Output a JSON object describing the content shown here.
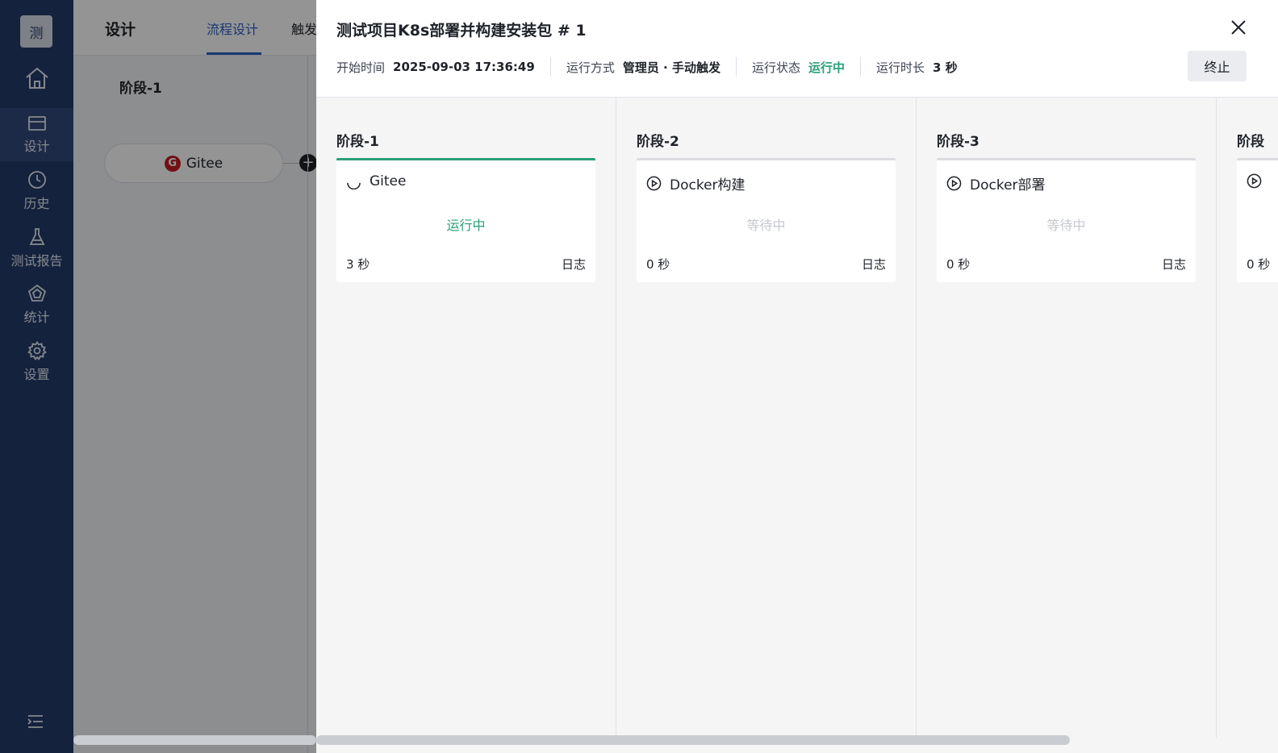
{
  "nav": {
    "logo": "测",
    "items": [
      {
        "label": "设计",
        "icon": "design-icon",
        "active": true
      },
      {
        "label": "历史",
        "icon": "clock-icon",
        "active": false
      },
      {
        "label": "测试报告",
        "icon": "flask-icon",
        "active": false
      },
      {
        "label": "统计",
        "icon": "chart-icon",
        "active": false
      },
      {
        "label": "设置",
        "icon": "gear-icon",
        "active": false
      }
    ]
  },
  "page": {
    "title": "设计",
    "tabs": [
      {
        "label": "流程设计",
        "active": true
      },
      {
        "label": "触发",
        "active": false
      }
    ],
    "stage_title": "阶段-1",
    "source_node": "Gitee"
  },
  "drawer": {
    "title": "测试项目K8s部署并构建安装包 # 1",
    "meta": {
      "start_label": "开始时间",
      "start_value": "2025-09-03 17:36:49",
      "mode_label": "运行方式",
      "mode_value": "管理员 · 手动触发",
      "status_label": "运行状态",
      "status_value": "运行中",
      "duration_label": "运行时长",
      "duration_value": "3 秒"
    },
    "stop_label": "终止",
    "stages": [
      {
        "name": "阶段-1",
        "job": {
          "name": "Gitee",
          "status": "运行中",
          "time": "3 秒",
          "log": "日志",
          "running": true
        }
      },
      {
        "name": "阶段-2",
        "job": {
          "name": "Docker构建",
          "status": "等待中",
          "time": "0 秒",
          "log": "日志",
          "running": false
        }
      },
      {
        "name": "阶段-3",
        "job": {
          "name": "Docker部署",
          "status": "等待中",
          "time": "0 秒",
          "log": "日志",
          "running": false
        }
      },
      {
        "name": "阶段",
        "job": {
          "name": "",
          "status": "",
          "time": "0 秒",
          "log": "",
          "running": false
        }
      }
    ]
  },
  "colors": {
    "nav_bg": "#243b6b",
    "accent_blue": "#2d5fc4",
    "running_green": "#2aa079",
    "waiting_gray": "#c5c8cd"
  }
}
